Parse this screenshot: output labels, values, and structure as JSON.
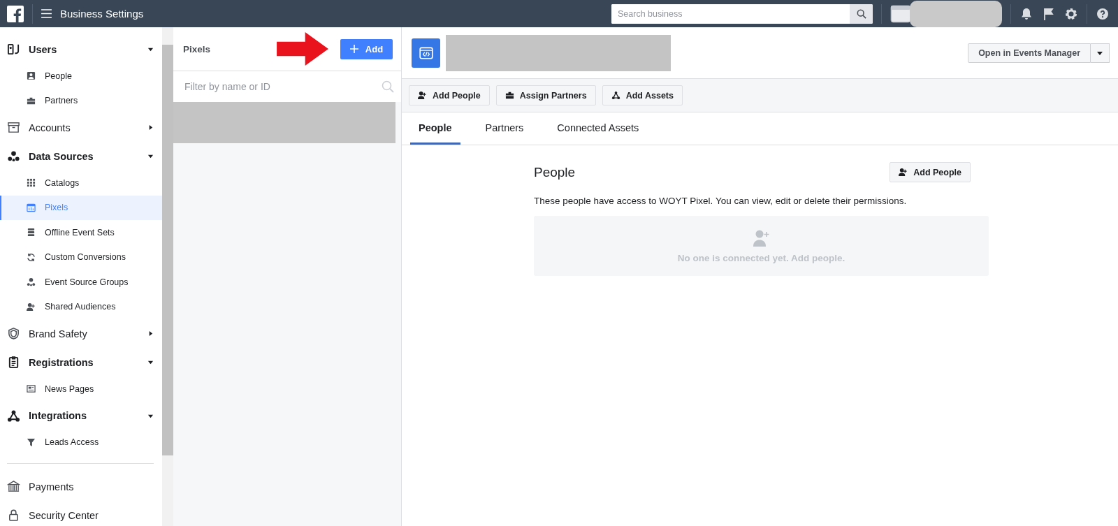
{
  "top_bar": {
    "title": "Business Settings",
    "search": {
      "placeholder": "Search business"
    }
  },
  "sidebar": {
    "groups": [
      {
        "kind": "group",
        "label": "Users",
        "expanded": true,
        "children": [
          {
            "label": "People",
            "selected": false
          },
          {
            "label": "Partners",
            "selected": false
          }
        ]
      },
      {
        "kind": "group",
        "label": "Accounts",
        "expanded": false
      },
      {
        "kind": "group",
        "label": "Data Sources",
        "expanded": true,
        "children": [
          {
            "label": "Catalogs",
            "selected": false
          },
          {
            "label": "Pixels",
            "selected": true
          },
          {
            "label": "Offline Event Sets",
            "selected": false
          },
          {
            "label": "Custom Conversions",
            "selected": false
          },
          {
            "label": "Event Source Groups",
            "selected": false
          },
          {
            "label": "Shared Audiences",
            "selected": false
          }
        ]
      },
      {
        "kind": "group",
        "label": "Brand Safety",
        "expanded": false
      },
      {
        "kind": "group",
        "label": "Registrations",
        "expanded": true,
        "children": [
          {
            "label": "News Pages",
            "selected": false
          }
        ]
      },
      {
        "kind": "group",
        "label": "Integrations",
        "expanded": true,
        "children": [
          {
            "label": "Leads Access",
            "selected": false
          }
        ]
      },
      {
        "kind": "divider"
      },
      {
        "kind": "link",
        "label": "Payments"
      },
      {
        "kind": "link",
        "label": "Security Center"
      }
    ]
  },
  "list_panel": {
    "title": "Pixels",
    "add_button": "Add",
    "filter": {
      "placeholder": "Filter by name or ID"
    }
  },
  "detail": {
    "open_button": "Open in Events Manager",
    "toolbar": [
      "Add People",
      "Assign Partners",
      "Add Assets"
    ],
    "tabs": [
      {
        "label": "People",
        "selected": true
      },
      {
        "label": "Partners",
        "selected": false
      },
      {
        "label": "Connected Assets",
        "selected": false
      }
    ],
    "section": {
      "title": "People",
      "add_button": "Add People",
      "description": "These people have access to WOYT Pixel. You can view, edit or delete their permissions.",
      "empty_text": "No one is connected yet. Add people."
    }
  }
}
